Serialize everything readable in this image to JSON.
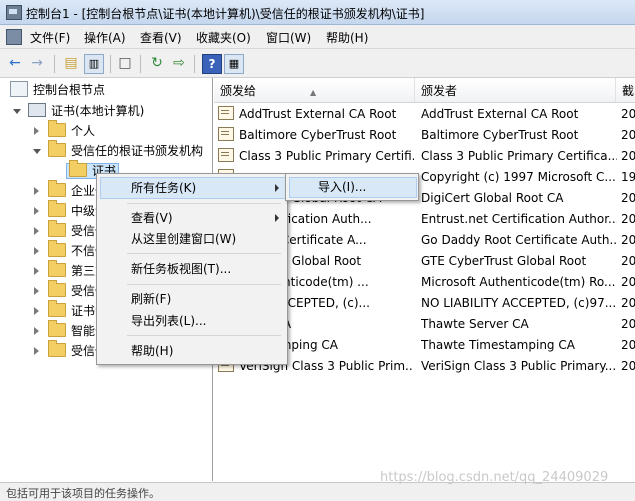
{
  "window": {
    "title": "控制台1 - [控制台根节点\\证书(本地计算机)\\受信任的根证书颁发机构\\证书]"
  },
  "menu": [
    "文件(F)",
    "操作(A)",
    "查看(V)",
    "收藏夹(O)",
    "窗口(W)",
    "帮助(H)"
  ],
  "toolbar": {
    "icons": [
      "back-arrow-icon",
      "forward-arrow-icon",
      "up-folder-icon",
      "show-hide-tree-icon",
      "properties-icon",
      "refresh-icon",
      "export-list-icon",
      "help-icon",
      "show-hide-action-pane-icon"
    ]
  },
  "tree": {
    "root": "控制台根节点",
    "cert_store": "证书(本地计算机)",
    "personal": "个人",
    "trusted_root": "受信任的根证书颁发机构",
    "certificates": "证书",
    "enterprise": "企业信",
    "intermediate": "中级证",
    "untrusted_trusted": "受信任",
    "untrusted": "不信任",
    "third_party": "第三方",
    "trusted_people": "受信任",
    "cert_enroll": "证书注",
    "smart_card": "智能卡",
    "trusted_devices": "受信任"
  },
  "list": {
    "columns": [
      "颁发给",
      "颁发者",
      "截"
    ],
    "rows": [
      {
        "issued_to": "AddTrust External CA Root",
        "issuer": "AddTrust External CA Root",
        "exp": "20"
      },
      {
        "issued_to": "Baltimore CyberTrust Root",
        "issuer": "Baltimore CyberTrust Root",
        "exp": "20"
      },
      {
        "issued_to": "Class 3 Public Primary Certifi...",
        "issuer": "Class 3 Public Primary Certifica...",
        "exp": "20"
      },
      {
        "issued_to": "",
        "issuer": "Copyright (c) 1997 Microsoft C...",
        "exp": "19"
      },
      {
        "issued_to": "DigiCert Global Root CA",
        "issuer": "DigiCert Global Root CA",
        "exp": "20"
      },
      {
        "issued_to": "et Certification Auth...",
        "issuer": "Entrust.net Certification Author...",
        "exp": "20"
      },
      {
        "issued_to": "y Root Certificate A...",
        "issuer": "Go Daddy Root Certificate Auth...",
        "exp": "20"
      },
      {
        "issued_to": "berTrust Global Root",
        "issuer": "GTE CyberTrust Global Root",
        "exp": "20"
      },
      {
        "issued_to": "t Authenticode(tm) ...",
        "issuer": "Microsoft Authenticode(tm) Ro...",
        "exp": "20"
      },
      {
        "issued_to": "ILITY ACCEPTED, (c)...",
        "issuer": "NO LIABILITY ACCEPTED, (c)97...",
        "exp": "20"
      },
      {
        "issued_to": "erver CA",
        "issuer": "Thawte Server CA",
        "exp": "20"
      },
      {
        "issued_to": "imestamping CA",
        "issuer": "Thawte Timestamping CA",
        "exp": "20"
      },
      {
        "issued_to": "VeriSign Class 3 Public Prim...",
        "issuer": "VeriSign Class 3 Public Primary...",
        "exp": "20"
      }
    ]
  },
  "context_menu": {
    "all_tasks": "所有任务(K)",
    "view": "查看(V)",
    "new_window": "从这里创建窗口(W)",
    "new_taskpad": "新任务板视图(T)...",
    "refresh": "刷新(F)",
    "export_list": "导出列表(L)...",
    "help": "帮助(H)"
  },
  "submenu": {
    "import": "导入(I)..."
  },
  "status": {
    "text": "包括可用于该项目的任务操作。"
  },
  "watermark": "https://blog.csdn.net/qq_24409029"
}
